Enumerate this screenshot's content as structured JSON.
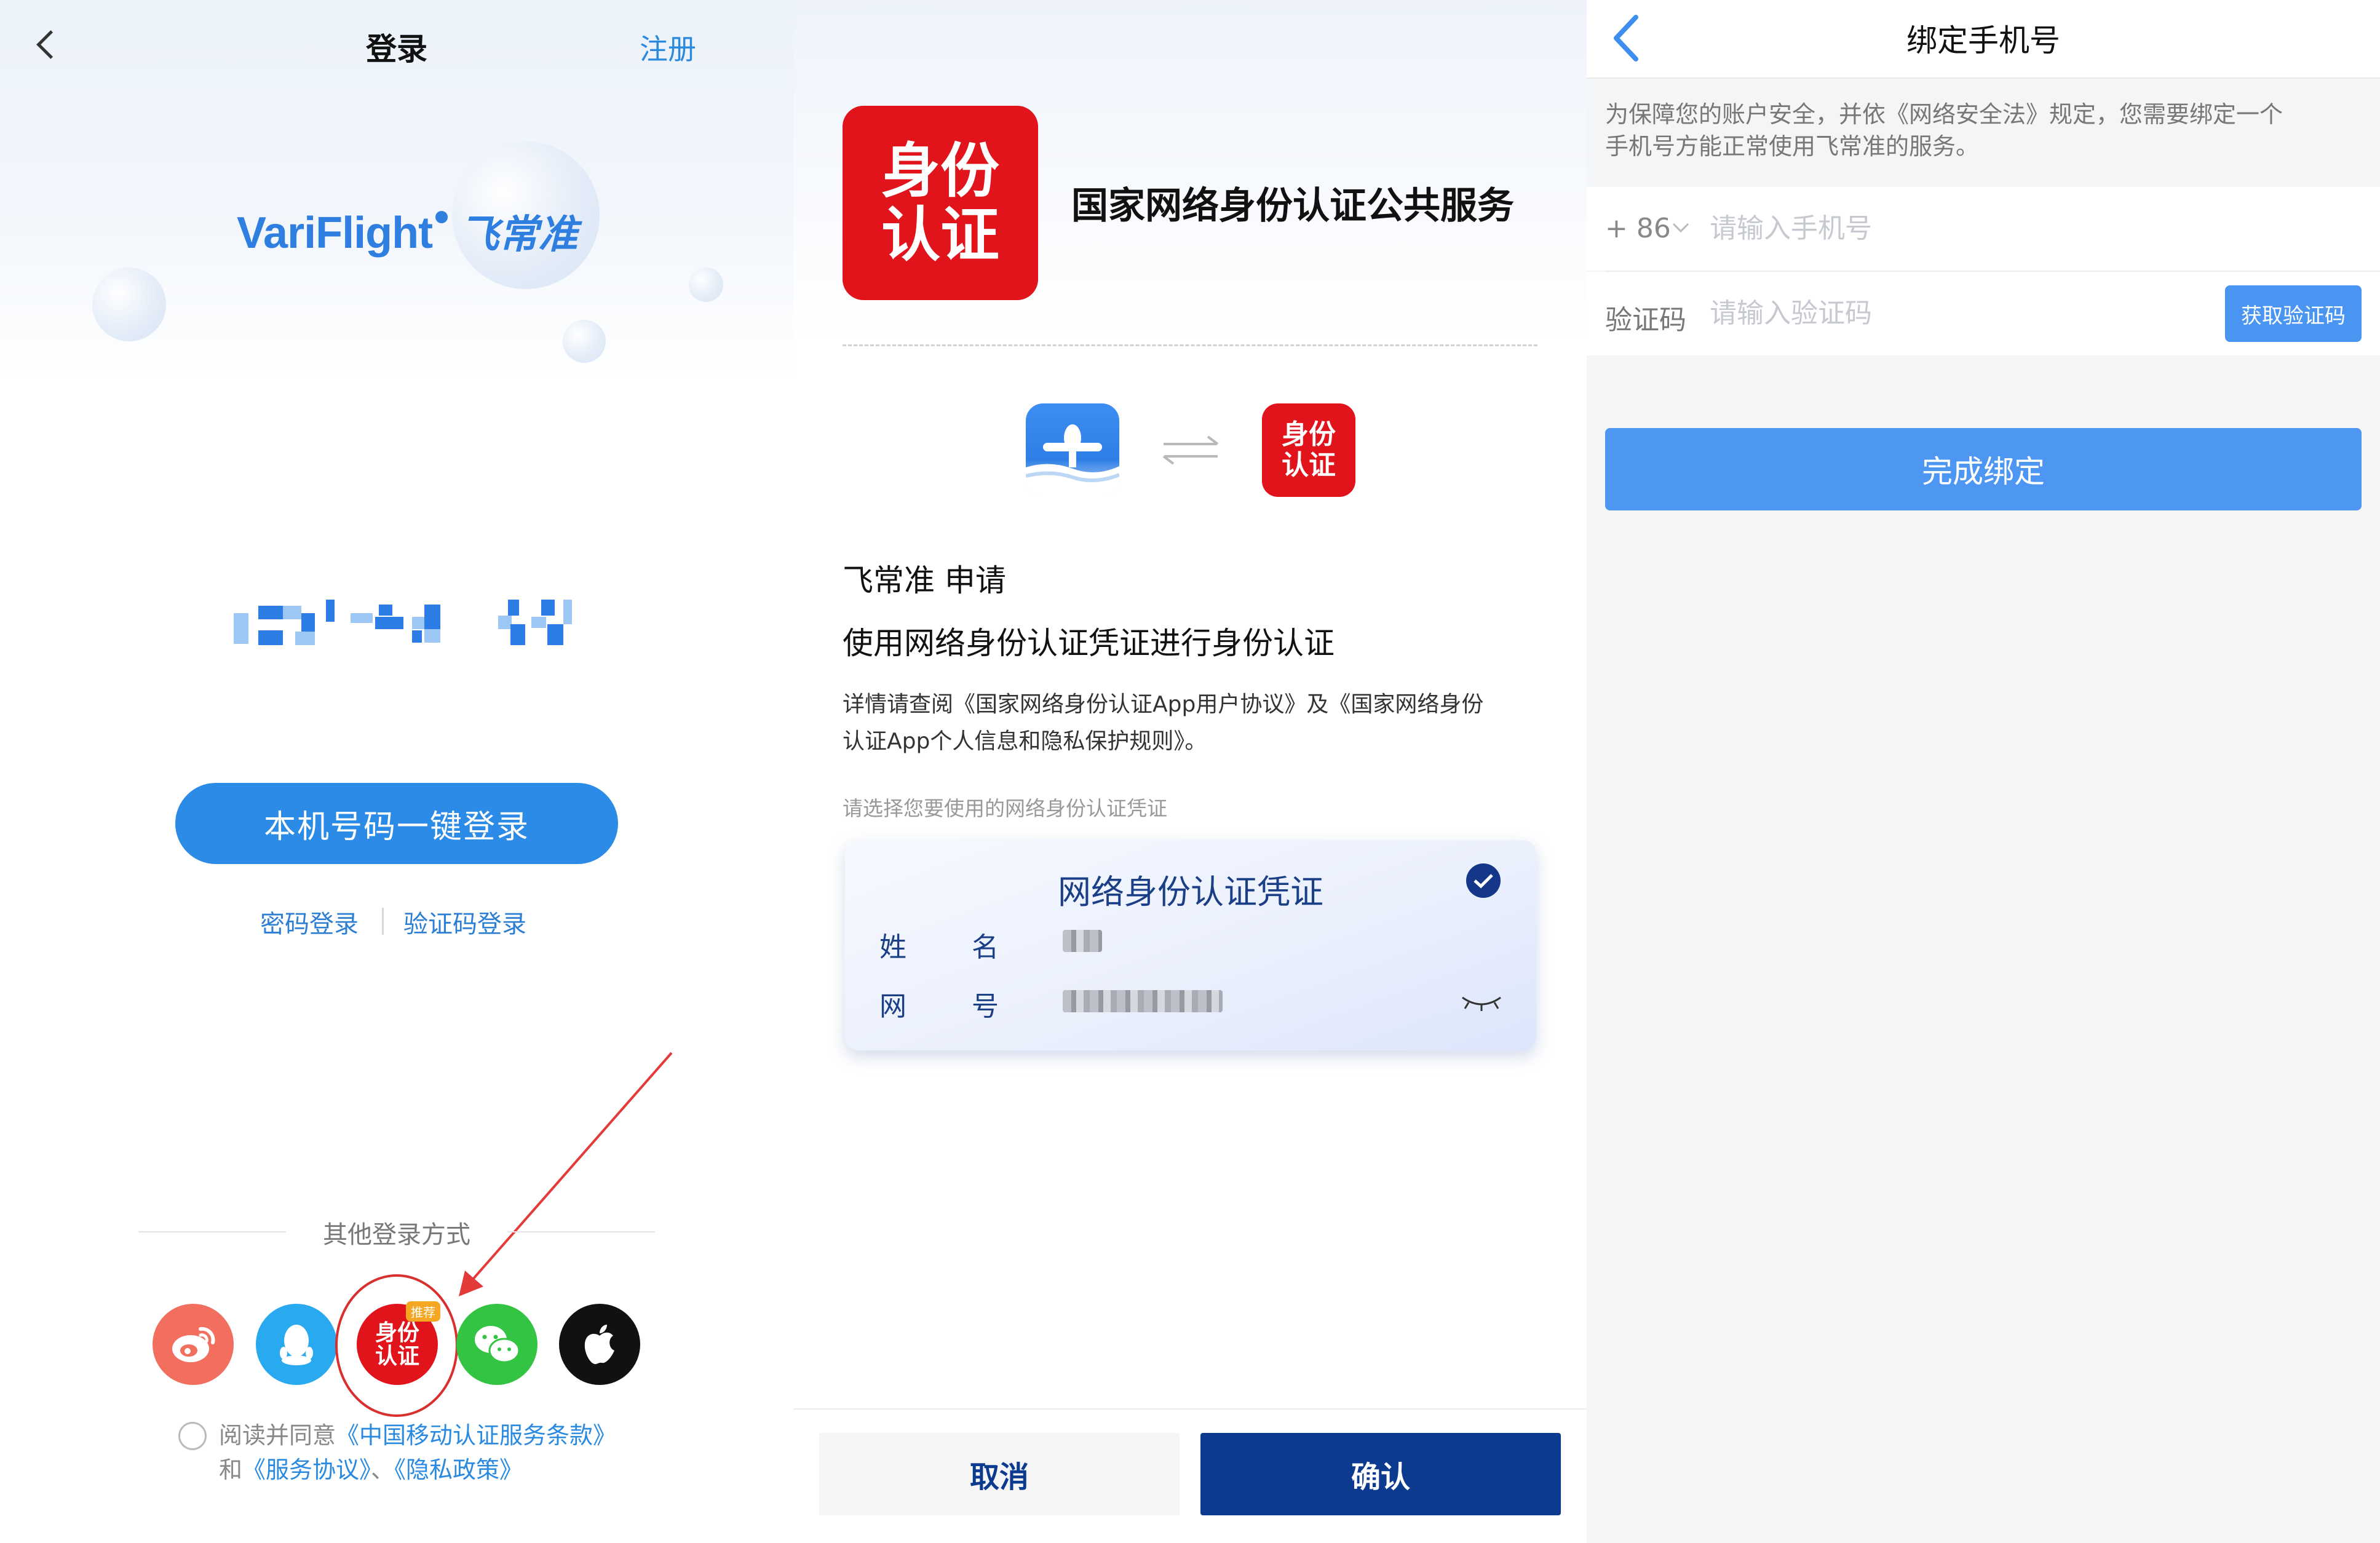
{
  "login": {
    "title": "登录",
    "register_label": "注册",
    "logo_en": "VariFlight",
    "logo_cn": "飞常准",
    "one_click_login": "本机号码一键登录",
    "password_login": "密码登录",
    "code_login": "验证码登录",
    "other_methods": "其他登录方式",
    "recommend_badge": "推荐",
    "id_icon_line1": "身份",
    "id_icon_line2": "认证",
    "agreement": {
      "prefix": "阅读并同意",
      "cmcc_terms": "《中国移动认证服务条款》",
      "and": "和",
      "service": "《服务协议》",
      "sep": "、",
      "privacy": "《隐私政策》"
    },
    "social_icons": [
      "weibo-icon",
      "qq-icon",
      "id-auth-icon",
      "wechat-icon",
      "apple-icon"
    ],
    "colors": {
      "accent": "#2b8be6",
      "weibo": "#f26e5f",
      "qq": "#29a9f0",
      "id": "#e1131b",
      "wechat": "#33c443",
      "apple": "#111111"
    }
  },
  "auth": {
    "logo_line1": "身份",
    "logo_line2": "认证",
    "service_title": "国家网络身份认证公共服务",
    "apply_line": "飞常准 申请",
    "purpose": "使用网络身份认证凭证进行身份认证",
    "details_line1": "详情请查阅《国家网络身份认证App用户协议》及《国家网络身份",
    "details_line2": "认证App个人信息和隐私保护规则》。",
    "choose_hint": "请选择您要使用的网络身份认证凭证",
    "card": {
      "title": "网络身份认证凭证",
      "name_label_1": "姓",
      "name_label_2": "名",
      "id_label_1": "网",
      "id_label_2": "号"
    },
    "cancel": "取消",
    "confirm": "确认",
    "colors": {
      "brand_red": "#e1131b",
      "navy": "#0b3a8f"
    }
  },
  "bind": {
    "title": "绑定手机号",
    "notice_line1": "为保障您的账户安全，并依《网络安全法》规定，您需要绑定一个",
    "notice_line2": "手机号方能正常使用飞常准的服务。",
    "country_code": "+ 86",
    "phone_placeholder": "请输入手机号",
    "code_label": "验证码",
    "code_placeholder": "请输入验证码",
    "get_code": "获取验证码",
    "done": "完成绑定",
    "colors": {
      "accent": "#4d97f3"
    }
  }
}
